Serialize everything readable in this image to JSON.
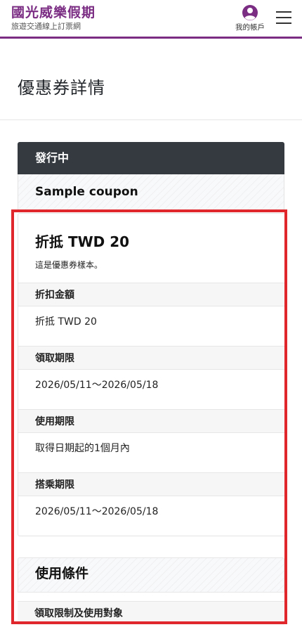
{
  "header": {
    "brand_title": "國光威樂假期",
    "brand_subtitle": "旅遊交通線上訂票網",
    "account_label": "我的帳戶"
  },
  "page": {
    "title": "優惠券詳情"
  },
  "coupon": {
    "status": "發行中",
    "name": "Sample coupon",
    "amount_title": "折抵 TWD 20",
    "description": "這是優惠券樣本。",
    "rows": [
      {
        "label": "折扣金額",
        "value": "折抵 TWD 20"
      },
      {
        "label": "領取期限",
        "value": "2026/05/11～2026/05/18"
      },
      {
        "label": "使用期限",
        "value": "取得日期起的1個月內"
      },
      {
        "label": "搭乘期限",
        "value": "2026/05/11～2026/05/18"
      }
    ]
  },
  "conditions": {
    "title": "使用條件",
    "first_label": "領取限制及使用對象"
  },
  "colors": {
    "brand": "#7b2d84",
    "status_bar": "#343a40",
    "highlight": "#e0282c"
  },
  "icons": {
    "account": "user-circle-icon",
    "menu": "hamburger-menu-icon"
  }
}
